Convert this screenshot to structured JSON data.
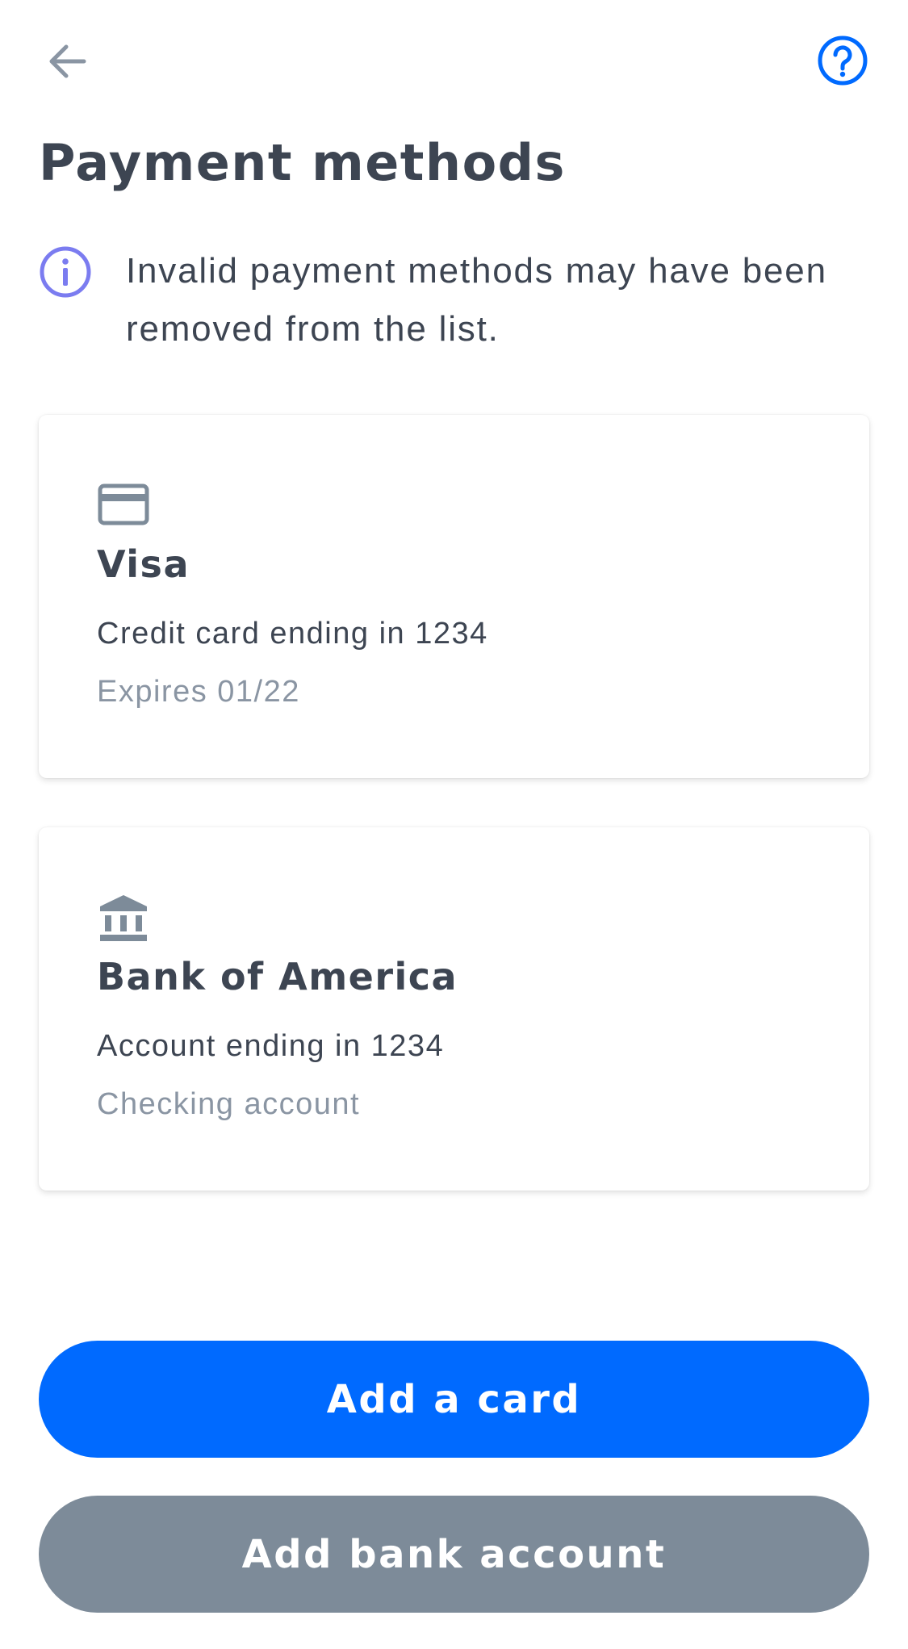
{
  "header": {
    "back_icon": "arrow-left-icon",
    "help_icon": "question-circle-icon",
    "title": "Payment methods"
  },
  "notice": {
    "icon": "info-circle-icon",
    "text": "Invalid payment methods may have been removed from the list."
  },
  "payment_methods": [
    {
      "icon": "credit-card-icon",
      "name": "Visa",
      "line1": "Credit card ending in 1234",
      "line2": "Expires 01/22"
    },
    {
      "icon": "bank-icon",
      "name": "Bank of America",
      "line1": "Account ending in 1234",
      "line2": "Checking account"
    }
  ],
  "actions": {
    "add_card_label": "Add a card",
    "add_bank_label": "Add bank account"
  },
  "colors": {
    "primary": "#006aff",
    "secondary": "#7d8b99",
    "text": "#3d4552",
    "muted_text": "#8a95a3",
    "info_icon": "#7b7cf0",
    "icon_gray": "#7d8b99"
  }
}
